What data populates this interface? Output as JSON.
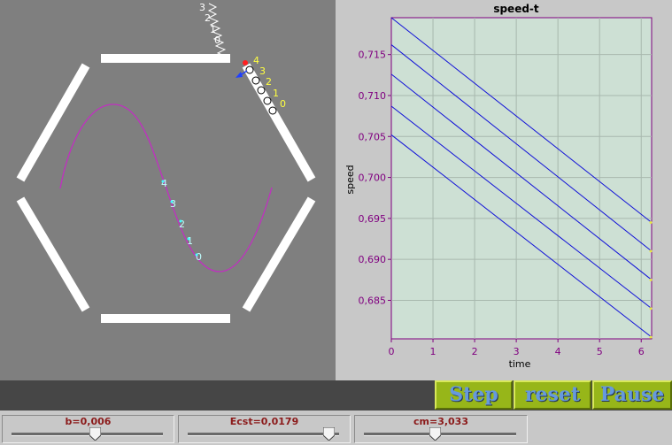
{
  "simulation": {
    "top_labels": [
      "3",
      "2",
      "1",
      "0"
    ],
    "wall_labels": [
      "4",
      "3",
      "2",
      "1",
      "0"
    ],
    "curve_labels": [
      "4",
      "3",
      "2",
      "1",
      "0"
    ]
  },
  "chart_data": {
    "type": "line",
    "title": "speed-t",
    "xlabel": "time",
    "ylabel": "speed",
    "xlim": [
      0,
      6.25
    ],
    "ylim": [
      0.6803,
      0.7195
    ],
    "xticks": [
      "0",
      "1",
      "2",
      "3",
      "4",
      "5",
      "6"
    ],
    "yticks": [
      "0,685",
      "0,690",
      "0,695",
      "0,700",
      "0,705",
      "0,710",
      "0,715"
    ],
    "ytick_values": [
      0.685,
      0.69,
      0.695,
      0.7,
      0.705,
      0.71,
      0.715
    ],
    "grid": true,
    "series": [
      {
        "x": [
          0,
          6.25
        ],
        "y": [
          0.7195,
          0.6945
        ]
      },
      {
        "x": [
          0,
          6.25
        ],
        "y": [
          0.7162,
          0.691
        ]
      },
      {
        "x": [
          0,
          6.25
        ],
        "y": [
          0.7126,
          0.6875
        ]
      },
      {
        "x": [
          0,
          6.25
        ],
        "y": [
          0.7087,
          0.684
        ]
      },
      {
        "x": [
          0,
          6.25
        ],
        "y": [
          0.7052,
          0.6805
        ]
      }
    ],
    "colors": {
      "line": "#1010d8",
      "axis": "#800080",
      "plot_bg": "#cde0d4",
      "grid": "#a8b8ae"
    }
  },
  "controls": {
    "step_label": "Step",
    "reset_label": "reset",
    "pause_label": "Pause"
  },
  "sliders": [
    {
      "label": "b=0,006",
      "fraction": 0.55
    },
    {
      "label": "Ecst=0,0179",
      "fraction": 0.93
    },
    {
      "label": "cm=3,033",
      "fraction": 0.47
    }
  ]
}
